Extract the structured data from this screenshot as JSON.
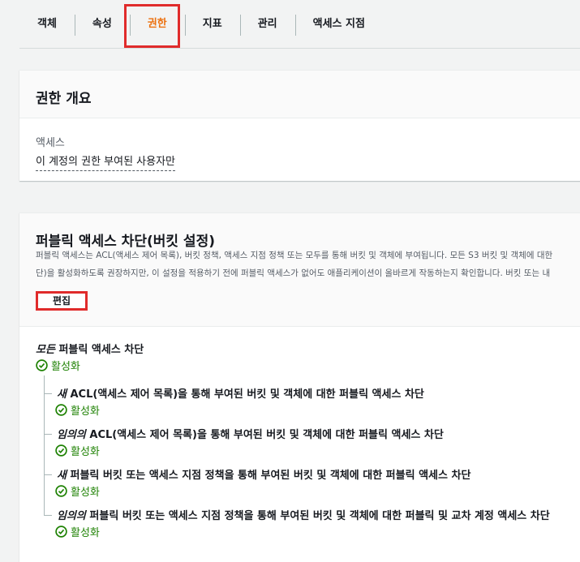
{
  "tabs": [
    {
      "label": "객체"
    },
    {
      "label": "속성"
    },
    {
      "label": "권한",
      "active": true
    },
    {
      "label": "지표"
    },
    {
      "label": "관리"
    },
    {
      "label": "액세스 지점"
    }
  ],
  "overview": {
    "title": "권한 개요",
    "access_label": "액세스",
    "access_value": "이 계정의 권한 부여된 사용자만"
  },
  "block_public": {
    "title": "퍼블릭 액세스 차단(버킷 설정)",
    "description_line1": "퍼블릭 액세스는 ACL(액세스 제어 목록), 버킷 정책, 액세스 지점 정책 또는 모두를 통해 버킷 및 객체에 부여됩니다. 모든 S3 버킷 및 객체에 대한",
    "description_line2": "단)을 활성화하도록 권장하지만, 이 설정을 적용하기 전에 퍼블릭 액세스가 없어도 애플리케이션이 올바르게 작동하는지 확인합니다. 버킷 또는 내",
    "edit_button": "편집",
    "all": {
      "label_italic": "모든",
      "label_rest": " 퍼블릭 액세스 차단",
      "status": "활성화"
    },
    "items": [
      {
        "label_italic": "새",
        "label_rest": " ACL(액세스 제어 목록)을 통해 부여된 버킷 및 객체에 대한 퍼블릭 액세스 차단",
        "status": "활성화"
      },
      {
        "label_italic": "임의의",
        "label_rest": " ACL(액세스 제어 목록)을 통해 부여된 버킷 및 객체에 대한 퍼블릭 액세스 차단",
        "status": "활성화"
      },
      {
        "label_italic": "새",
        "label_rest": " 퍼블릭 버킷 또는 액세스 지점 정책을 통해 부여된 버킷 및 객체에 대한 퍼블릭 액세스 차단",
        "status": "활성화"
      },
      {
        "label_italic": "임의의",
        "label_rest": " 퍼블릭 버킷 또는 액세스 지점 정책을 통해 부여된 버킷 및 객체에 대한 퍼블릭 및 교차 계정 액세스 차단",
        "status": "활성화"
      }
    ]
  },
  "colors": {
    "active_tab": "#ec7211",
    "success": "#1d8102",
    "highlight": "#e02b2b"
  },
  "icons": {
    "status": "check-circle-icon"
  }
}
